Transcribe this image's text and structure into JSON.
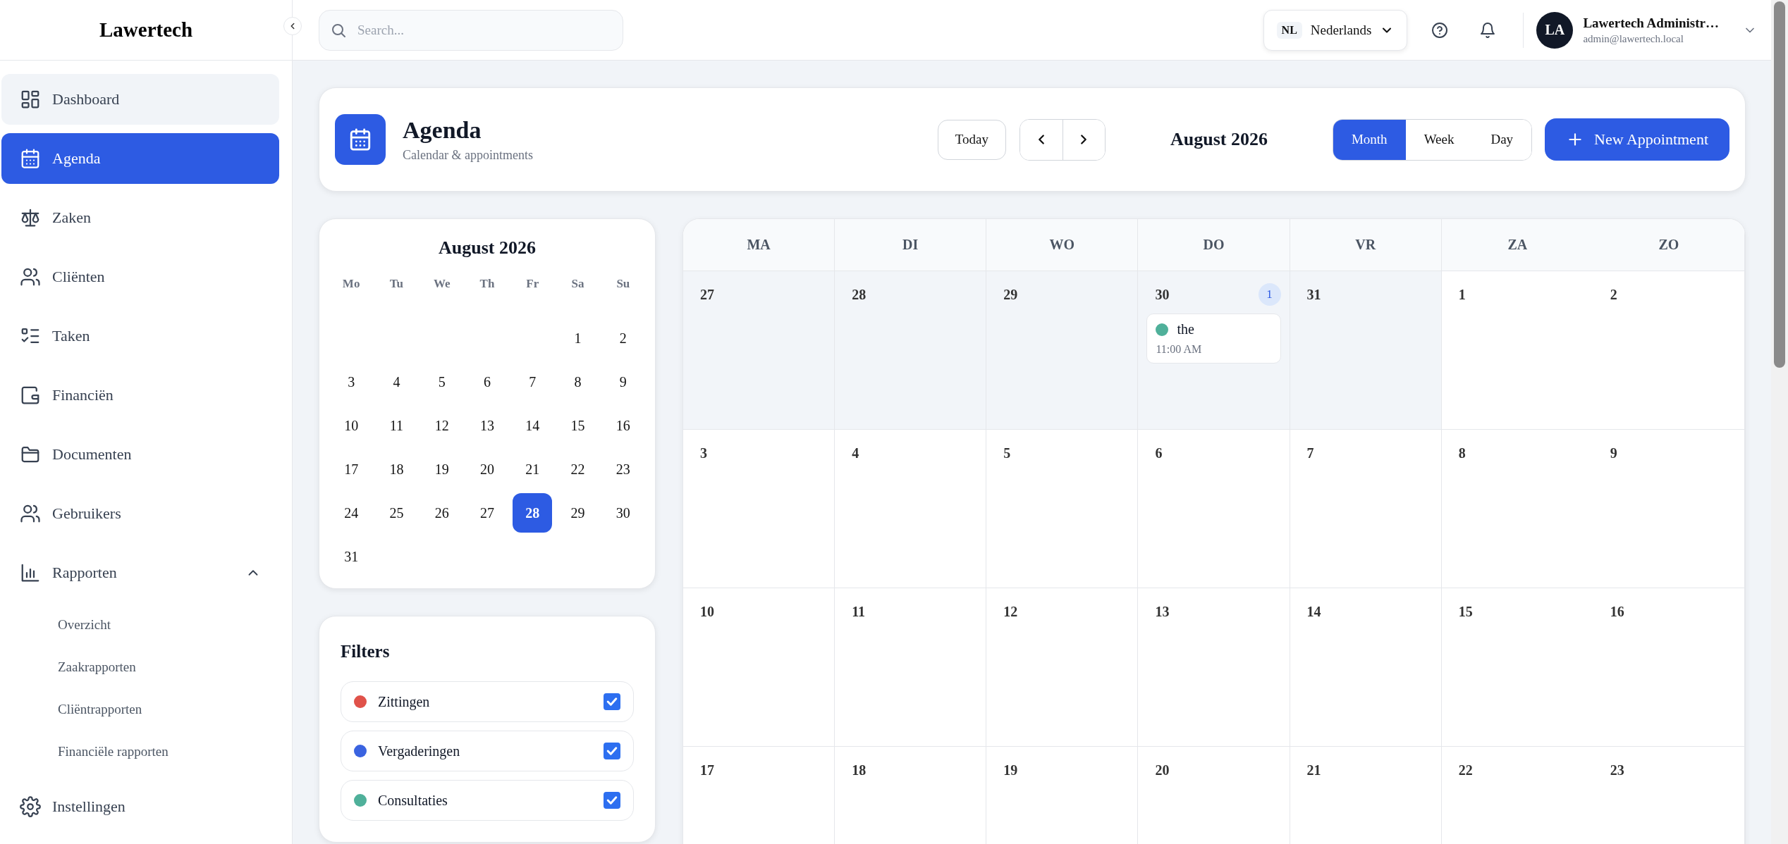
{
  "sidebar": {
    "logo": "Lawertech",
    "items": [
      {
        "label": "Dashboard",
        "selected": false,
        "hovered": true
      },
      {
        "label": "Agenda",
        "selected": true,
        "hovered": false
      },
      {
        "label": "Zaken",
        "selected": false,
        "hovered": false
      },
      {
        "label": "Cliënten",
        "selected": false,
        "hovered": false
      },
      {
        "label": "Taken",
        "selected": false,
        "hovered": false
      },
      {
        "label": "Financiën",
        "selected": false,
        "hovered": false
      },
      {
        "label": "Documenten",
        "selected": false,
        "hovered": false
      },
      {
        "label": "Gebruikers",
        "selected": false,
        "hovered": false
      },
      {
        "label": "Rapporten",
        "selected": false,
        "hovered": false,
        "expanded": true,
        "children": [
          {
            "label": "Overzicht"
          },
          {
            "label": "Zaakrapporten"
          },
          {
            "label": "Cliëntrapporten"
          },
          {
            "label": "Financiële rapporten"
          }
        ]
      },
      {
        "label": "Instellingen",
        "selected": false,
        "hovered": false
      }
    ]
  },
  "topbar": {
    "search": {
      "placeholder": "Search..."
    },
    "language": {
      "code": "NL",
      "label": "Nederlands"
    },
    "user": {
      "initials": "LA",
      "name": "Lawertech Administr…",
      "email": "admin@lawertech.local"
    }
  },
  "header": {
    "title": "Agenda",
    "subtitle": "Calendar & appointments",
    "today": "Today",
    "period": "August 2026",
    "views": [
      {
        "label": "Month",
        "selected": true
      },
      {
        "label": "Week",
        "selected": false
      },
      {
        "label": "Day",
        "selected": false
      }
    ],
    "new_button": "New Appointment"
  },
  "mini_calendar": {
    "title": "August 2026",
    "weekdays": [
      "Mo",
      "Tu",
      "We",
      "Th",
      "Fr",
      "Sa",
      "Su"
    ],
    "weeks": [
      [
        {
          "label": "1",
          "selected": false
        },
        {
          "label": "2",
          "selected": false
        }
      ],
      [
        {
          "label": "3",
          "selected": false
        },
        {
          "label": "4",
          "selected": false
        },
        {
          "label": "5",
          "selected": false
        },
        {
          "label": "6",
          "selected": false
        },
        {
          "label": "7",
          "selected": false
        },
        {
          "label": "8",
          "selected": false
        },
        {
          "label": "9",
          "selected": false
        }
      ],
      [
        {
          "label": "10",
          "selected": false
        },
        {
          "label": "11",
          "selected": false
        },
        {
          "label": "12",
          "selected": false
        },
        {
          "label": "13",
          "selected": false
        },
        {
          "label": "14",
          "selected": false
        },
        {
          "label": "15",
          "selected": false
        },
        {
          "label": "16",
          "selected": false
        }
      ],
      [
        {
          "label": "17",
          "selected": false
        },
        {
          "label": "18",
          "selected": false
        },
        {
          "label": "19",
          "selected": false
        },
        {
          "label": "20",
          "selected": false
        },
        {
          "label": "21",
          "selected": false
        },
        {
          "label": "22",
          "selected": false
        },
        {
          "label": "23",
          "selected": false
        }
      ],
      [
        {
          "label": "24",
          "selected": false
        },
        {
          "label": "25",
          "selected": false
        },
        {
          "label": "26",
          "selected": false
        },
        {
          "label": "27",
          "selected": false
        },
        {
          "label": "28",
          "selected": true
        },
        {
          "label": "29",
          "selected": false
        },
        {
          "label": "30",
          "selected": false
        }
      ],
      [
        {
          "label": "31",
          "selected": false
        }
      ]
    ]
  },
  "filters": {
    "title": "Filters",
    "items": [
      {
        "label": "Zittingen",
        "color": "#e0524a",
        "checked": true
      },
      {
        "label": "Vergaderingen",
        "color": "#3a63e0",
        "checked": true
      },
      {
        "label": "Consultaties",
        "color": "#4fb09a",
        "checked": true
      }
    ]
  },
  "month_grid": {
    "weekdays": [
      "MA",
      "DI",
      "WO",
      "DO",
      "VR",
      "ZA",
      "ZO"
    ],
    "weeks": [
      [
        {
          "day": "27",
          "outside": true
        },
        {
          "day": "28",
          "outside": true
        },
        {
          "day": "29",
          "outside": true
        },
        {
          "day": "30",
          "outside": true,
          "count": "1",
          "events": [
            {
              "title": "the",
              "time": "11:00 AM",
              "color": "#4fb09a"
            }
          ]
        },
        {
          "day": "31",
          "outside": true
        },
        {
          "day": "1",
          "outside": false
        },
        {
          "day": "2",
          "outside": false
        }
      ],
      [
        {
          "day": "3",
          "outside": false
        },
        {
          "day": "4",
          "outside": false
        },
        {
          "day": "5",
          "outside": false
        },
        {
          "day": "6",
          "outside": false
        },
        {
          "day": "7",
          "outside": false
        },
        {
          "day": "8",
          "outside": false
        },
        {
          "day": "9",
          "outside": false
        }
      ],
      [
        {
          "day": "10",
          "outside": false
        },
        {
          "day": "11",
          "outside": false
        },
        {
          "day": "12",
          "outside": false
        },
        {
          "day": "13",
          "outside": false
        },
        {
          "day": "14",
          "outside": false
        },
        {
          "day": "15",
          "outside": false
        },
        {
          "day": "16",
          "outside": false
        }
      ],
      [
        {
          "day": "17",
          "outside": false
        },
        {
          "day": "18",
          "outside": false
        },
        {
          "day": "19",
          "outside": false
        },
        {
          "day": "20",
          "outside": false
        },
        {
          "day": "21",
          "outside": false
        },
        {
          "day": "22",
          "outside": false
        },
        {
          "day": "23",
          "outside": false
        }
      ]
    ]
  }
}
